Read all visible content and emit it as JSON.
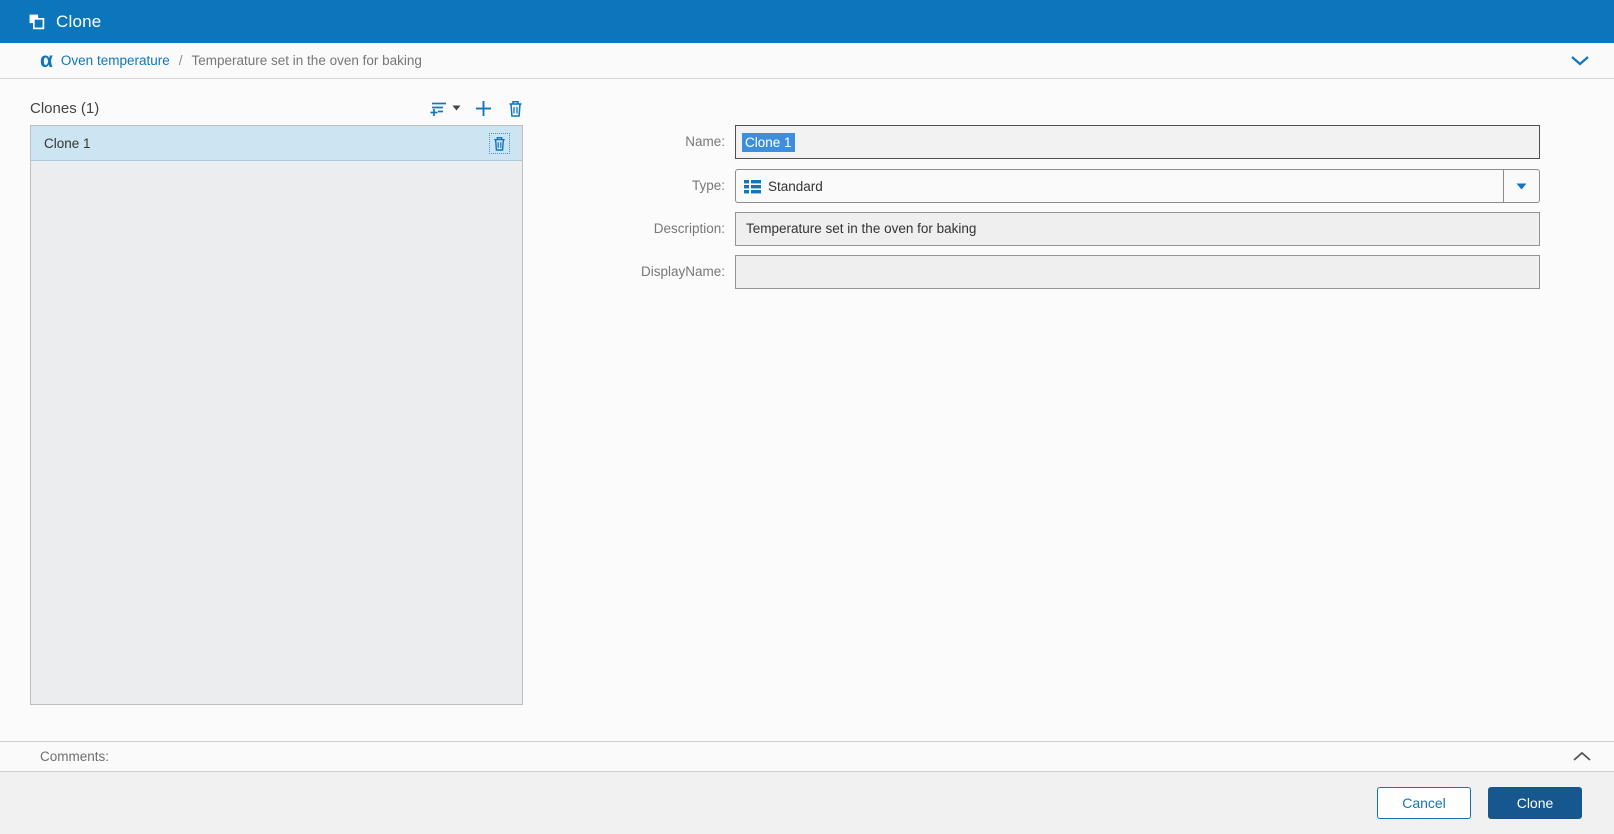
{
  "titlebar": {
    "title": "Clone"
  },
  "breadcrumb": {
    "alpha_glyph": "α",
    "root_link": "Oven temperature",
    "separator": "/",
    "current": "Temperature set in the oven for baking"
  },
  "clones_panel": {
    "header": "Clones (1)",
    "items": [
      {
        "name": "Clone 1"
      }
    ]
  },
  "form": {
    "name": {
      "label": "Name:",
      "value": "Clone 1",
      "selection": "full"
    },
    "type": {
      "label": "Type:",
      "value": "Standard",
      "icon": "element-template-list-icon"
    },
    "description": {
      "label": "Description:",
      "value": "Temperature set in the oven for baking"
    },
    "display_name": {
      "label": "DisplayName:",
      "value": ""
    }
  },
  "comments": {
    "label": "Comments:"
  },
  "footer": {
    "cancel_label": "Cancel",
    "clone_label": "Clone"
  },
  "icons": [
    "clone-icon",
    "alpha-attribute-icon",
    "chevron-down-icon",
    "add-filter-icon",
    "filter-caret-icon",
    "plus-icon",
    "trash-icon",
    "row-trash-icon",
    "combo-caret-icon",
    "chevron-up-icon"
  ],
  "colors": {
    "titlebar_blue": "#0c76bd",
    "accent_blue": "#1076bc",
    "selection_blue": "#3e8ede",
    "selected_row_bg": "#cde4f3",
    "clone_button_blue": "#15578e",
    "panel_bg": "#ebedee",
    "field_bg": "#efefef"
  }
}
